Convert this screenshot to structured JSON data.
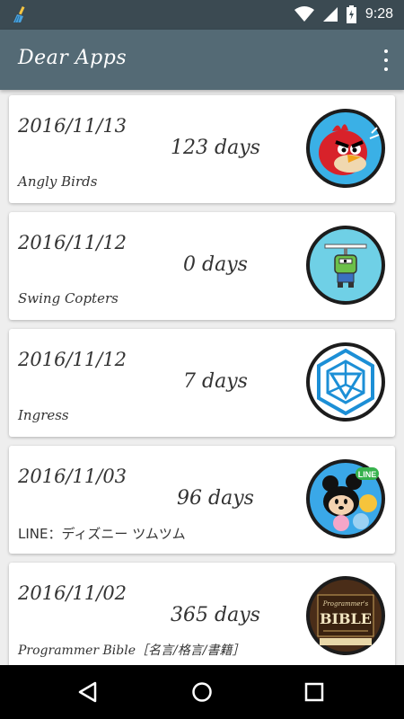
{
  "status_bar": {
    "time": "9:28",
    "icons": [
      "broom-icon",
      "wifi-icon",
      "signal-icon",
      "battery-icon"
    ]
  },
  "app_bar": {
    "title": "Dear Apps",
    "menu_icon": "more-vert-icon"
  },
  "apps": [
    {
      "date": "2016/11/13",
      "days": "123 days",
      "name": "Angly Birds",
      "icon": "angry-birds-icon"
    },
    {
      "date": "2016/11/12",
      "days": "0 days",
      "name": "Swing Copters",
      "icon": "swing-copters-icon"
    },
    {
      "date": "2016/11/12",
      "days": "7 days",
      "name": "Ingress",
      "icon": "ingress-icon"
    },
    {
      "date": "2016/11/03",
      "days": "96 days",
      "name": "LINE：ディズニー ツムツム",
      "icon": "tsum-tsum-icon"
    },
    {
      "date": "2016/11/02",
      "days": "365 days",
      "name": "Programmer Bible［名言/格言/書籍］",
      "icon": "programmers-bible-icon"
    }
  ],
  "icon_texts": {
    "line": "LINE",
    "bible_top": "Programmer's",
    "bible_main": "BIBLE"
  },
  "nav_bar": {
    "buttons": [
      "back-icon",
      "home-icon",
      "recents-icon"
    ]
  },
  "colors": {
    "status_bar": "#3b4a52",
    "app_bar": "#546a75",
    "background": "#eeeeee"
  }
}
